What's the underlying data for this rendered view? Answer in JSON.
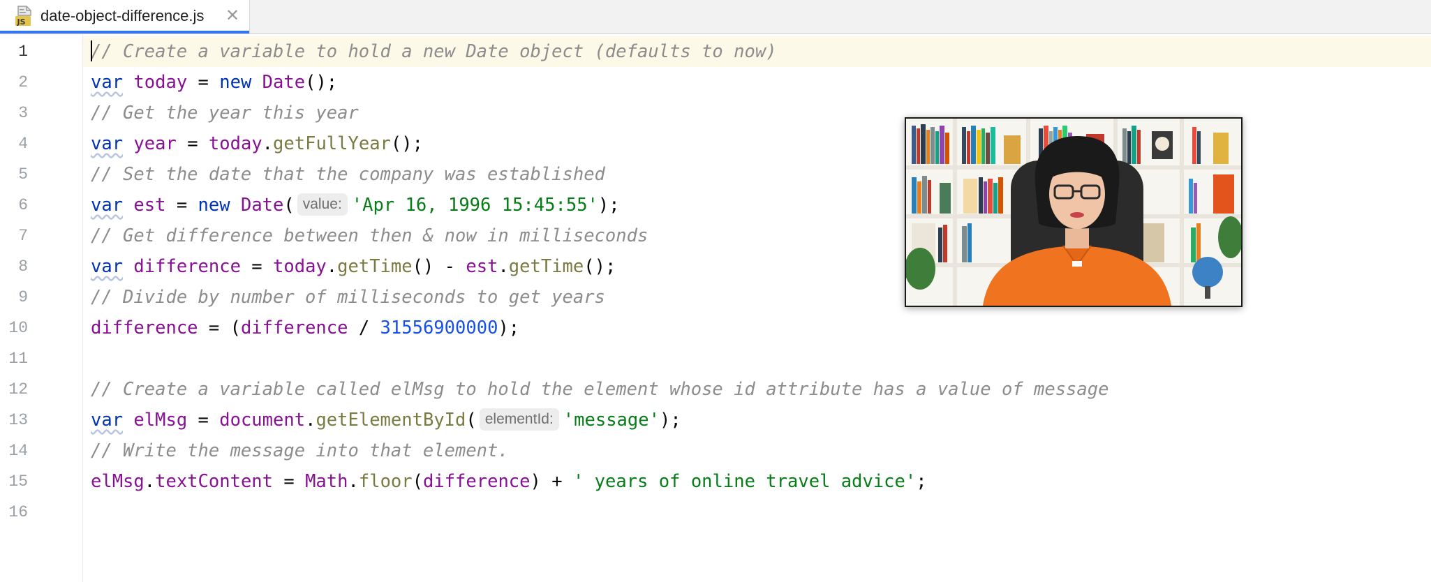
{
  "tab": {
    "file_name": "date-object-difference.js",
    "file_icon": "js-file-icon",
    "close_glyph": "✕"
  },
  "editor": {
    "current_line": 1,
    "line_numbers": [
      "1",
      "2",
      "3",
      "4",
      "5",
      "6",
      "7",
      "8",
      "9",
      "10",
      "11",
      "12",
      "13",
      "14",
      "15",
      "16"
    ],
    "lines": [
      [
        {
          "t": "cm",
          "v": "// Create a variable to hold a new Date object (defaults to now)"
        }
      ],
      [
        {
          "t": "kw",
          "v": "var"
        },
        {
          "t": "op",
          "v": " "
        },
        {
          "t": "vr",
          "v": "today"
        },
        {
          "t": "op",
          "v": " = "
        },
        {
          "t": "kwp",
          "v": "new"
        },
        {
          "t": "op",
          "v": " "
        },
        {
          "t": "cls",
          "v": "Date"
        },
        {
          "t": "op",
          "v": "();"
        }
      ],
      [
        {
          "t": "cm",
          "v": "// Get the year this year"
        }
      ],
      [
        {
          "t": "kw",
          "v": "var"
        },
        {
          "t": "op",
          "v": " "
        },
        {
          "t": "vr",
          "v": "year"
        },
        {
          "t": "op",
          "v": " = "
        },
        {
          "t": "vr",
          "v": "today"
        },
        {
          "t": "op",
          "v": "."
        },
        {
          "t": "fn",
          "v": "getFullYear"
        },
        {
          "t": "op",
          "v": "();"
        }
      ],
      [
        {
          "t": "cm",
          "v": "// Set the date that the company was established"
        }
      ],
      [
        {
          "t": "kw",
          "v": "var"
        },
        {
          "t": "op",
          "v": " "
        },
        {
          "t": "vr",
          "v": "est"
        },
        {
          "t": "op",
          "v": " = "
        },
        {
          "t": "kwp",
          "v": "new"
        },
        {
          "t": "op",
          "v": " "
        },
        {
          "t": "cls",
          "v": "Date"
        },
        {
          "t": "op",
          "v": "("
        },
        {
          "t": "hint",
          "v": "value:"
        },
        {
          "t": "str",
          "v": "'Apr 16, 1996 15:45:55'"
        },
        {
          "t": "op",
          "v": ");"
        }
      ],
      [
        {
          "t": "cm",
          "v": "// Get difference between then & now in milliseconds"
        }
      ],
      [
        {
          "t": "kw",
          "v": "var"
        },
        {
          "t": "op",
          "v": " "
        },
        {
          "t": "vr",
          "v": "difference"
        },
        {
          "t": "op",
          "v": " = "
        },
        {
          "t": "vr",
          "v": "today"
        },
        {
          "t": "op",
          "v": "."
        },
        {
          "t": "fn",
          "v": "getTime"
        },
        {
          "t": "op",
          "v": "() - "
        },
        {
          "t": "vr",
          "v": "est"
        },
        {
          "t": "op",
          "v": "."
        },
        {
          "t": "fn",
          "v": "getTime"
        },
        {
          "t": "op",
          "v": "();"
        }
      ],
      [
        {
          "t": "cm",
          "v": "// Divide by number of milliseconds to get years"
        }
      ],
      [
        {
          "t": "vr",
          "v": "difference"
        },
        {
          "t": "op",
          "v": " = ("
        },
        {
          "t": "vr",
          "v": "difference"
        },
        {
          "t": "op",
          "v": " / "
        },
        {
          "t": "num",
          "v": "31556900000"
        },
        {
          "t": "op",
          "v": ");"
        }
      ],
      [],
      [
        {
          "t": "cm",
          "v": "// Create a variable called elMsg to hold the element whose id attribute has a value of message"
        }
      ],
      [
        {
          "t": "kw",
          "v": "var"
        },
        {
          "t": "op",
          "v": " "
        },
        {
          "t": "vr",
          "v": "elMsg"
        },
        {
          "t": "op",
          "v": " = "
        },
        {
          "t": "vr",
          "v": "document"
        },
        {
          "t": "op",
          "v": "."
        },
        {
          "t": "fn",
          "v": "getElementById"
        },
        {
          "t": "op",
          "v": "("
        },
        {
          "t": "hint",
          "v": "elementId:"
        },
        {
          "t": "str",
          "v": "'message'"
        },
        {
          "t": "op",
          "v": ");"
        }
      ],
      [
        {
          "t": "cm",
          "v": "// Write the message into that element."
        }
      ],
      [
        {
          "t": "vr",
          "v": "elMsg"
        },
        {
          "t": "op",
          "v": "."
        },
        {
          "t": "vr",
          "v": "textContent"
        },
        {
          "t": "op",
          "v": " = "
        },
        {
          "t": "cls",
          "v": "Math"
        },
        {
          "t": "op",
          "v": "."
        },
        {
          "t": "fn",
          "v": "floor"
        },
        {
          "t": "op",
          "v": "("
        },
        {
          "t": "vr",
          "v": "difference"
        },
        {
          "t": "op",
          "v": ") + "
        },
        {
          "t": "str",
          "v": "' years of online travel advice'"
        },
        {
          "t": "op",
          "v": ";"
        }
      ],
      []
    ]
  },
  "webcam": {
    "description_icon": "webcam-video-overlay"
  },
  "colors": {
    "keyword": "#0033b3",
    "variable": "#871094",
    "method": "#7a7a43",
    "string": "#067d17",
    "number": "#1750eb",
    "comment": "#8c8c8c",
    "current_line": "#fdf9e8",
    "tab_underline": "#3574f0"
  }
}
